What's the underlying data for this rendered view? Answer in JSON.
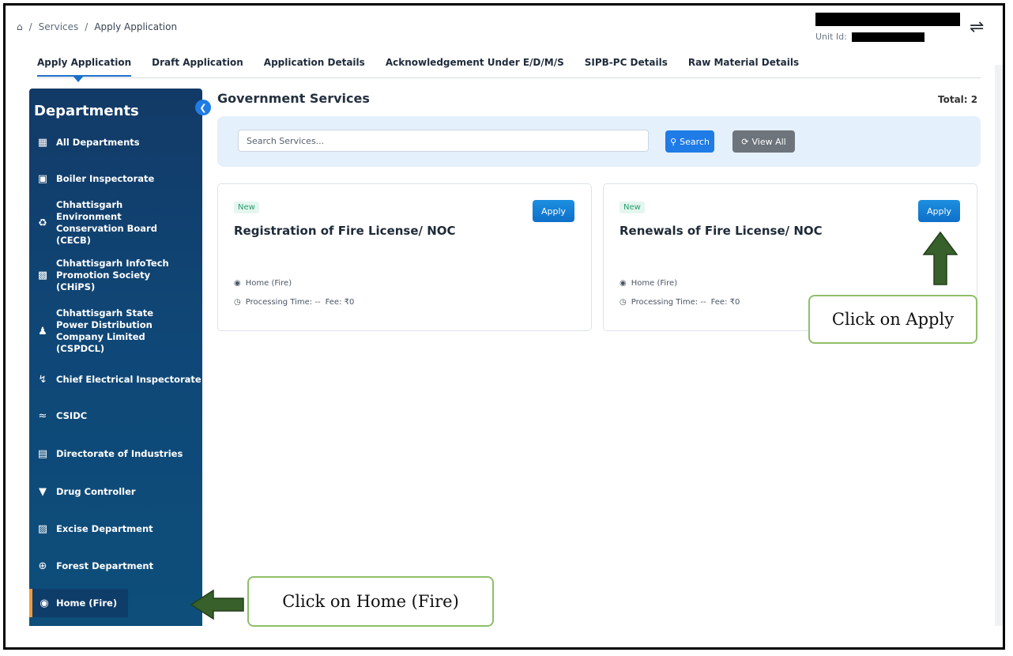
{
  "breadcrumb": {
    "sep": "/",
    "items": [
      "Services",
      "Apply Application"
    ]
  },
  "header": {
    "unit_label": "Unit Id:"
  },
  "tabs": [
    {
      "label": "Apply Application"
    },
    {
      "label": "Draft Application"
    },
    {
      "label": "Application Details"
    },
    {
      "label": "Acknowledgement Under E/D/M/S"
    },
    {
      "label": "SIPB-PC Details"
    },
    {
      "label": "Raw Material Details"
    }
  ],
  "sidebar": {
    "title": "Departments",
    "items": [
      {
        "label": "All Departments",
        "icon": "grid-icon"
      },
      {
        "label": "Boiler Inspectorate",
        "icon": "boiler-icon"
      },
      {
        "label": "Chhattisgarh Environment Conservation Board (CECB)",
        "icon": "recycle-icon"
      },
      {
        "label": "Chhattisgarh InfoTech Promotion Society (CHiPS)",
        "icon": "chip-icon"
      },
      {
        "label": "Chhattisgarh State Power Distribution Company Limited (CSPDCL)",
        "icon": "people-icon"
      },
      {
        "label": "Chief Electrical Inspectorate",
        "icon": "bolt-icon"
      },
      {
        "label": "CSIDC",
        "icon": "wave-icon"
      },
      {
        "label": "Directorate of Industries",
        "icon": "factory-icon"
      },
      {
        "label": "Drug Controller",
        "icon": "pill-icon"
      },
      {
        "label": "Excise Department",
        "icon": "document-icon"
      },
      {
        "label": "Forest Department",
        "icon": "tree-icon"
      },
      {
        "label": "Home (Fire)",
        "icon": "fire-icon"
      }
    ]
  },
  "main": {
    "title": "Government Services",
    "total": "Total: 2",
    "search_placeholder": "Search Services...",
    "search_label": "Search",
    "view_all_label": "View All",
    "cards": [
      {
        "badge": "New",
        "title": "Registration of Fire License/ NOC",
        "apply": "Apply",
        "dept": "Home (Fire)",
        "processing": "Processing Time: --",
        "fee": "Fee: ₹0"
      },
      {
        "badge": "New",
        "title": "Renewals of Fire License/ NOC",
        "apply": "Apply",
        "dept": "Home (Fire)",
        "processing": "Processing Time: --",
        "fee": "Fee: ₹0"
      }
    ]
  },
  "annotations": {
    "apply_callout": "Click on Apply",
    "home_callout": "Click on Home (Fire)",
    "arrow_color": "#38602a"
  }
}
